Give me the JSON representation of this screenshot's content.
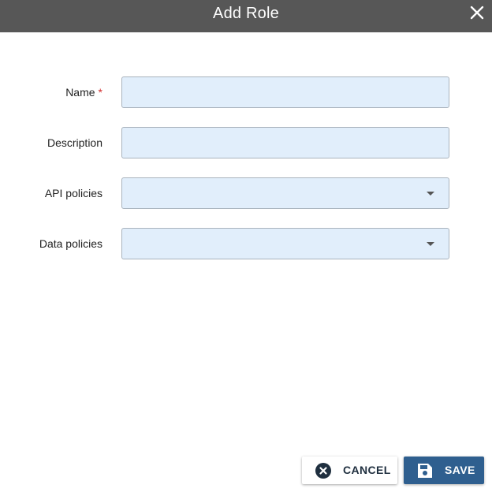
{
  "dialog": {
    "title": "Add Role",
    "close_icon": "close-icon"
  },
  "form": {
    "name": {
      "label": "Name",
      "required_marker": "*",
      "value": ""
    },
    "description": {
      "label": "Description",
      "value": ""
    },
    "api_policies": {
      "label": "API policies",
      "selected": "",
      "icon": "chevron-down-icon"
    },
    "data_policies": {
      "label": "Data policies",
      "selected": "",
      "icon": "chevron-down-icon"
    }
  },
  "actions": {
    "cancel": {
      "label": "CANCEL",
      "icon": "cancel-circle-icon"
    },
    "save": {
      "label": "SAVE",
      "icon": "save-floppy-icon"
    }
  },
  "colors": {
    "titlebar": "#575757",
    "field_background": "#e1eefb",
    "field_border": "#a9b3bd",
    "required": "#d32f2f",
    "save_button": "#2f5f8f"
  }
}
